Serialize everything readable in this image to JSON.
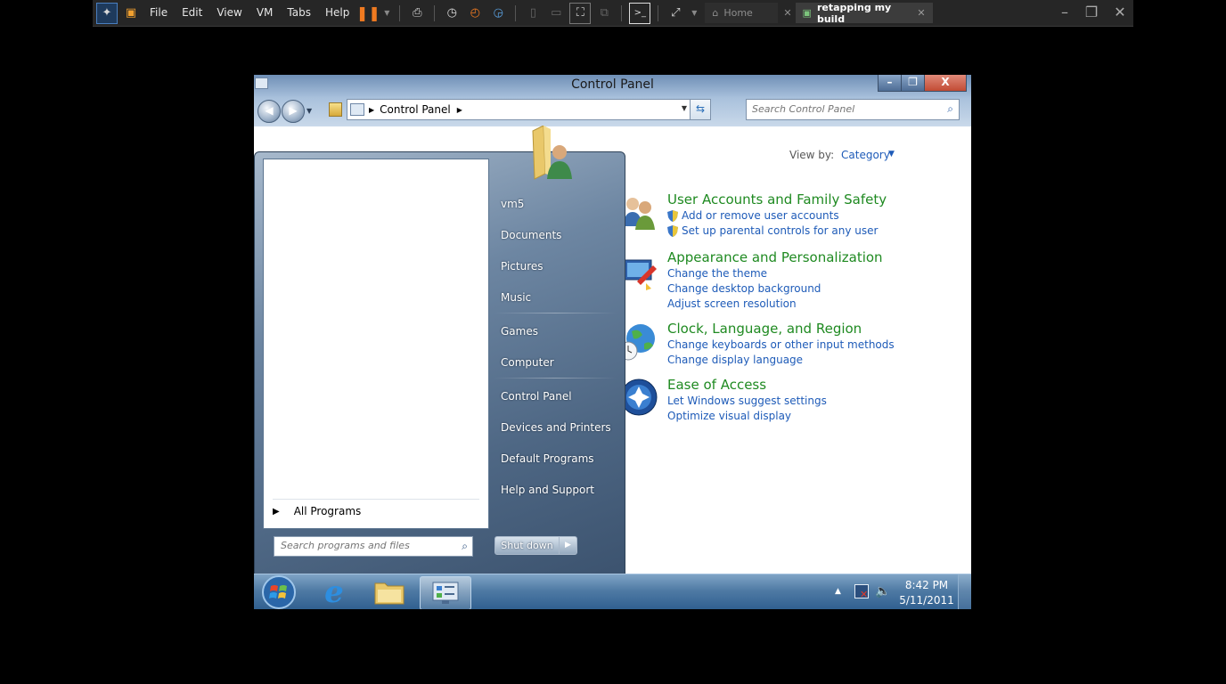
{
  "host": {
    "menus": [
      "File",
      "Edit",
      "View",
      "VM",
      "Tabs",
      "Help"
    ],
    "tabs": {
      "home": {
        "label": "Home",
        "close": "✕"
      },
      "vm": {
        "label": "retapping my build",
        "close": "✕"
      }
    }
  },
  "window": {
    "title": "Control Panel",
    "buttons": {
      "minimize": "–",
      "maximize": "❐",
      "close": "X"
    },
    "address": {
      "crumb": "Control Panel"
    },
    "search_placeholder": "Search Control Panel"
  },
  "content": {
    "view_by_label": "View by:",
    "view_by_value": "Category",
    "categories": [
      {
        "title": "User Accounts and Family Safety",
        "links": [
          "Add or remove user accounts",
          "Set up parental controls for any user"
        ],
        "icon": "users-icon"
      },
      {
        "title": "Appearance and Personalization",
        "links": [
          "Change the theme",
          "Change desktop background",
          "Adjust screen resolution"
        ],
        "icon": "appearance-icon"
      },
      {
        "title": "Clock, Language, and Region",
        "links": [
          "Change keyboards or other input methods",
          "Change display language"
        ],
        "icon": "globe-clock-icon"
      },
      {
        "title": "Ease of Access",
        "links": [
          "Let Windows suggest settings",
          "Optimize visual display"
        ],
        "icon": "ease-of-access-icon"
      }
    ]
  },
  "start_menu": {
    "all_programs": "All Programs",
    "search_placeholder": "Search programs and files",
    "right_items": {
      "user": "vm5",
      "documents": "Documents",
      "pictures": "Pictures",
      "music": "Music",
      "games": "Games",
      "computer": "Computer",
      "control_panel": "Control Panel",
      "devices": "Devices and Printers",
      "default_programs": "Default Programs",
      "help": "Help and Support"
    },
    "shutdown_label": "Shut down"
  },
  "taskbar": {
    "time": "8:42 PM",
    "date": "5/11/2011"
  },
  "colors": {
    "category_title": "#1f8a21",
    "link": "#1e5bb8"
  }
}
